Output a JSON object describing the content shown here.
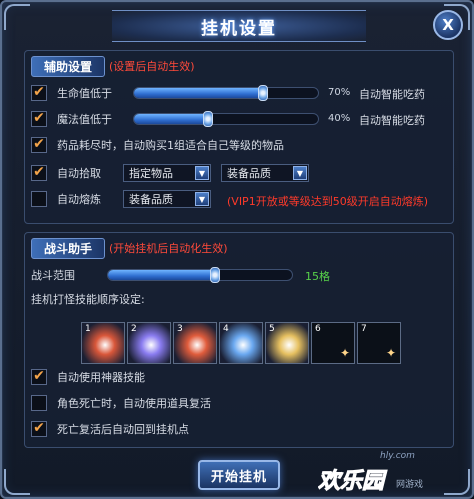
{
  "window": {
    "title": "挂机设置",
    "close_label": "X"
  },
  "aux": {
    "title": "辅助设置",
    "note": "(设置后自动生效)",
    "hp": {
      "label": "生命值低于",
      "value_percent": 70,
      "percent_text": "70%",
      "action": "自动智能吃药",
      "checked": true
    },
    "mp": {
      "label": "魔法值低于",
      "value_percent": 40,
      "percent_text": "40%",
      "action": "自动智能吃药",
      "checked": true
    },
    "potion": {
      "label": "药品耗尽时，自动购买1组适合自己等级的物品",
      "checked": true
    },
    "pickup": {
      "label": "自动拾取",
      "select1": "指定物品",
      "select2": "装备品质",
      "checked": true
    },
    "smelt": {
      "label": "自动熔炼",
      "select1": "装备品质",
      "warning": "(VIP1开放或等级达到50级开启自动熔炼)",
      "checked": false
    }
  },
  "battle": {
    "title": "战斗助手",
    "note": "(开始挂机后自动化生效)",
    "range": {
      "label": "战斗范围",
      "value_text": "15格",
      "value": 15,
      "fill_fraction": 0.58
    },
    "skill_order_label": "挂机打怪技能顺序设定:",
    "skills": [
      {
        "num": "1",
        "icon": "fire-orb-skill-icon",
        "empty": false,
        "color": "#d9573a"
      },
      {
        "num": "2",
        "icon": "lightning-burst-skill-icon",
        "empty": false,
        "color": "#8a7cf0"
      },
      {
        "num": "3",
        "icon": "flame-wave-skill-icon",
        "empty": false,
        "color": "#e05c3c"
      },
      {
        "num": "4",
        "icon": "ice-shard-skill-icon",
        "empty": false,
        "color": "#6aa8f0"
      },
      {
        "num": "5",
        "icon": "nature-blast-skill-icon",
        "empty": false,
        "color": "#e6c060"
      },
      {
        "num": "6",
        "icon": "empty-slot-icon",
        "empty": true,
        "color": "#000000"
      },
      {
        "num": "7",
        "icon": "empty-slot-icon",
        "empty": true,
        "color": "#000000"
      }
    ],
    "artifact": {
      "label": "自动使用神器技能",
      "checked": true
    },
    "revive_item": {
      "label": "角色死亡时，自动使用道具复活",
      "checked": false
    },
    "return_point": {
      "label": "死亡复活后自动回到挂机点",
      "checked": true
    }
  },
  "start_button": "开始挂机",
  "watermark": {
    "url": "hly.com",
    "logo_text": "欢乐园",
    "small": "网游戏"
  },
  "colors": {
    "accent": "#3e6fb8",
    "warning": "#ff3a2a",
    "check": "#f2a34a",
    "range_value": "#57d14a"
  }
}
